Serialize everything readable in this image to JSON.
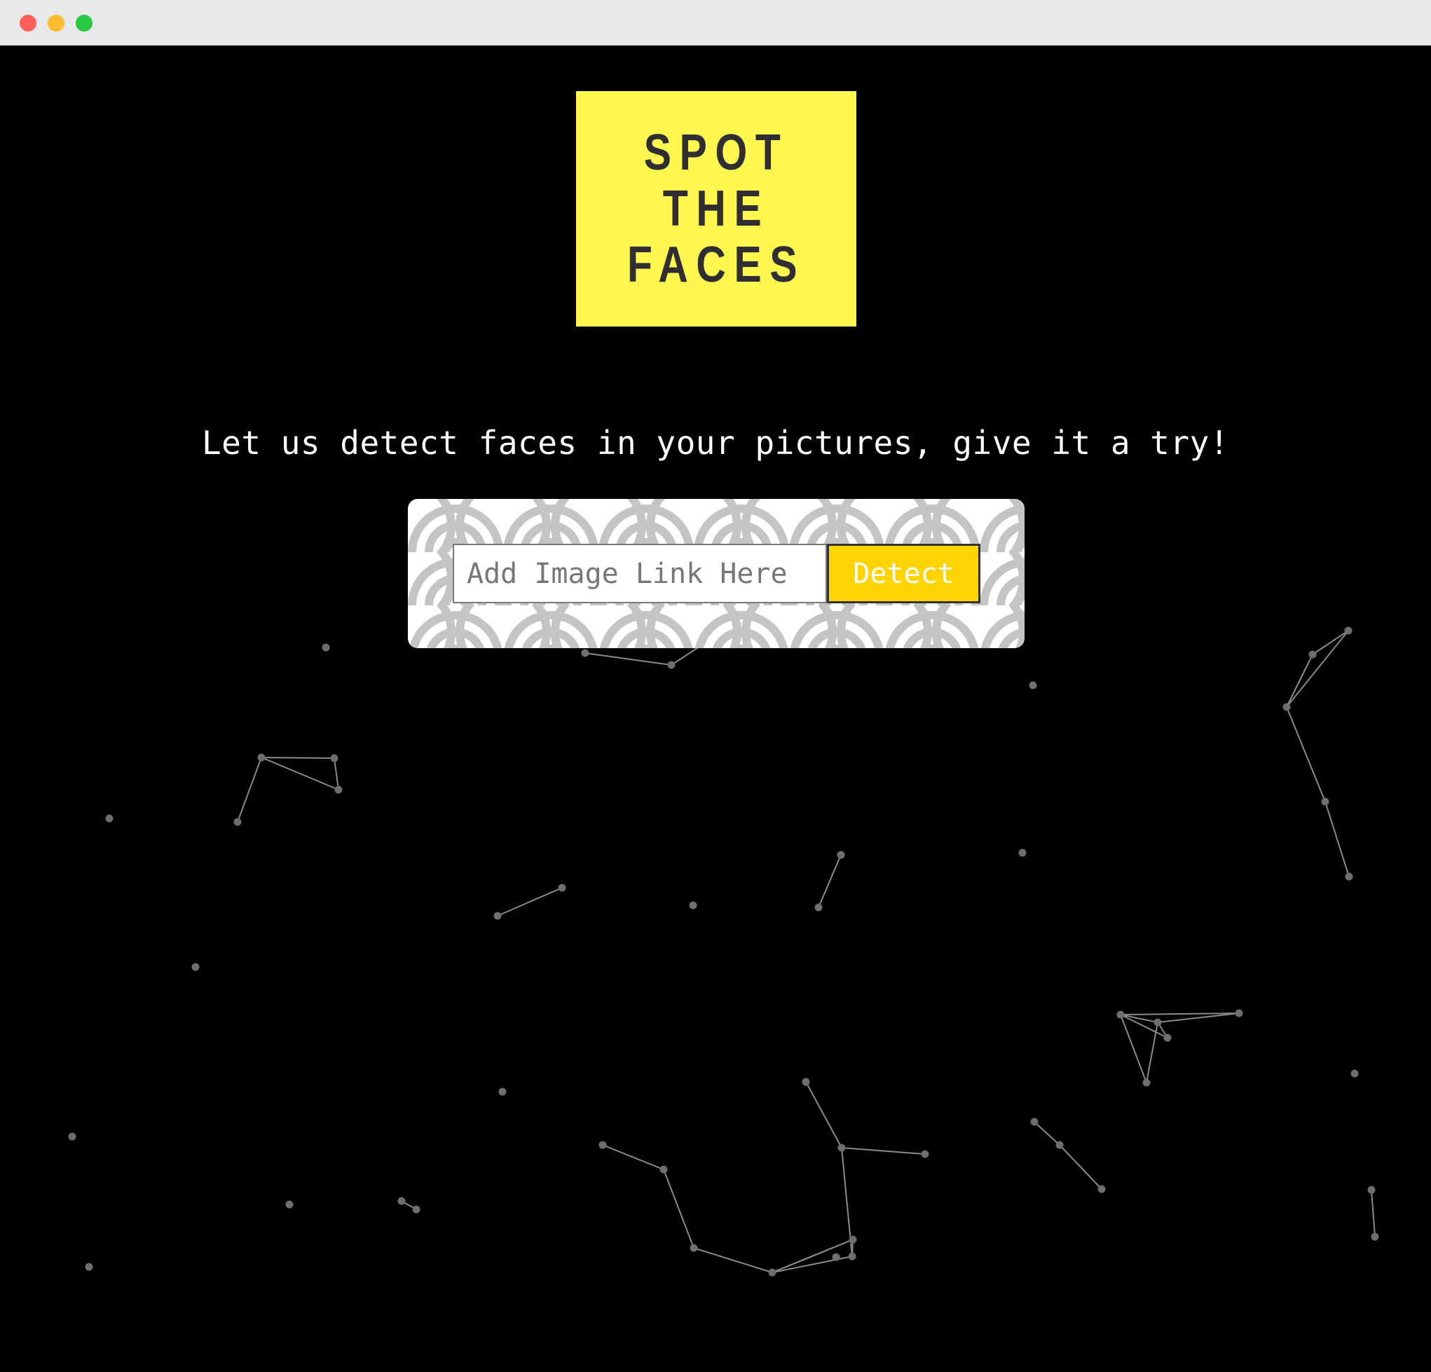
{
  "logo": {
    "lines": [
      "SPOT",
      "THE",
      "FACES"
    ],
    "background": "#fff64f",
    "text_color": "#2e2e33"
  },
  "tagline": "Let us detect faces in your pictures, give it a try!",
  "form": {
    "input_value": "",
    "input_placeholder": "Add Image Link Here",
    "detect_label": "Detect",
    "button_color": "#ffd400",
    "pattern_color": "#c4c4c4"
  },
  "window": {
    "controls": [
      "close-icon",
      "minimize-icon",
      "zoom-icon"
    ],
    "background": "#000000"
  }
}
